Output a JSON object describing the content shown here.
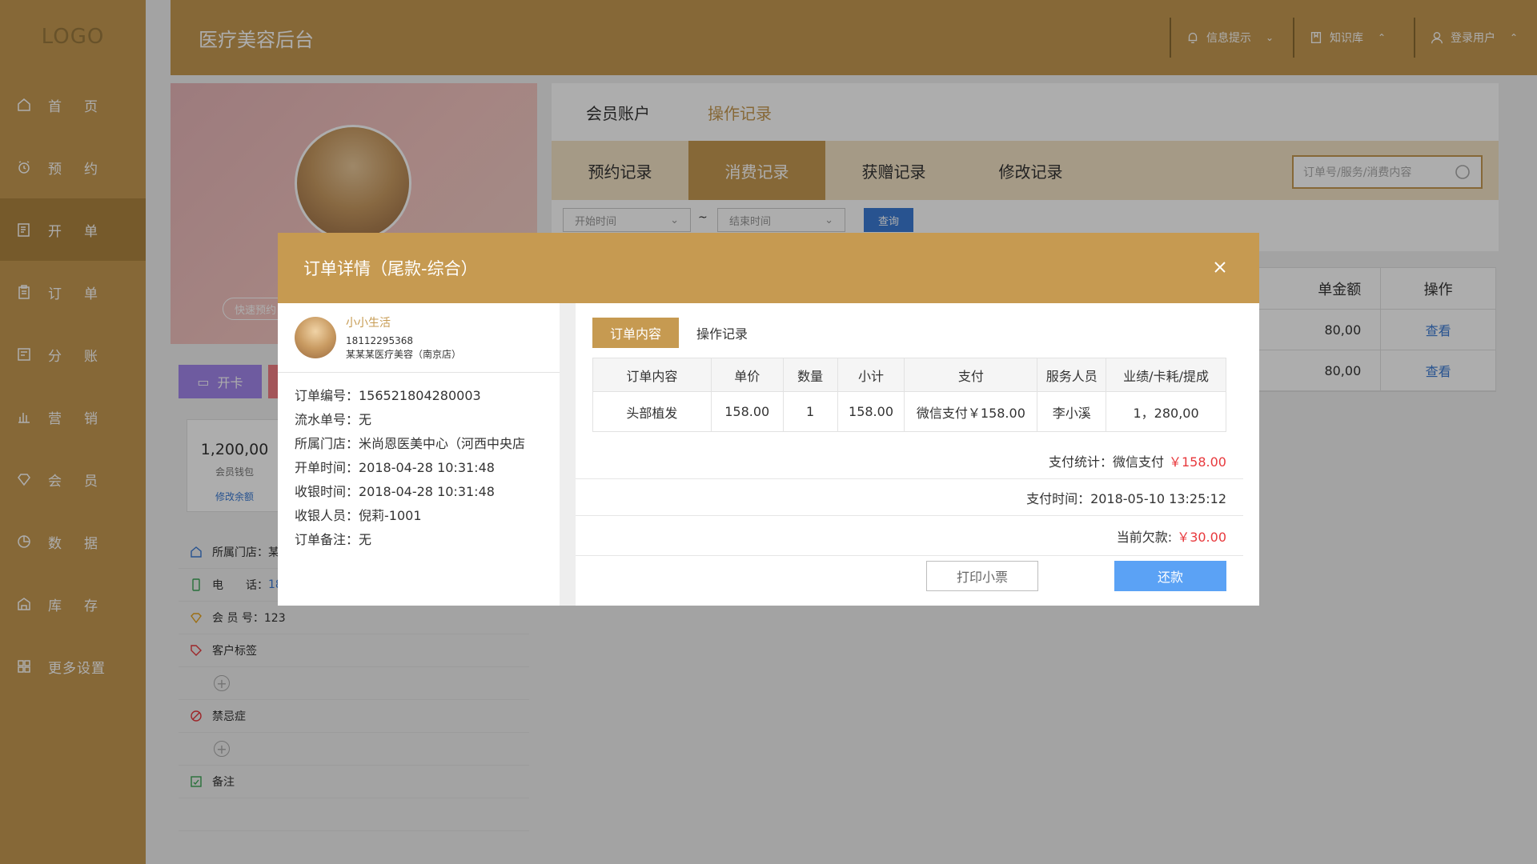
{
  "app": {
    "logo": "LOGO",
    "title": "医疗美容后台"
  },
  "sidebar": {
    "items": [
      {
        "label": "首页",
        "icon": "home-icon"
      },
      {
        "label": "预约",
        "icon": "alarm-icon"
      },
      {
        "label": "开单",
        "icon": "edit-doc-icon"
      },
      {
        "label": "订单",
        "icon": "clipboard-icon"
      },
      {
        "label": "分账",
        "icon": "ledger-icon"
      },
      {
        "label": "营销",
        "icon": "bar-chart-icon"
      },
      {
        "label": "会员",
        "icon": "diamond-icon"
      },
      {
        "label": "数据",
        "icon": "pie-icon"
      },
      {
        "label": "库存",
        "icon": "warehouse-icon"
      },
      {
        "label": "更多设置",
        "icon": "grid-icon"
      }
    ],
    "active_index": 2
  },
  "header": {
    "notifications": "信息提示",
    "knowledge": "知识库",
    "user": "登录用户"
  },
  "profile": {
    "quick_chip": "快速预约",
    "open_card": "开卡",
    "wallet_amount": "1,200,00",
    "wallet_label": "会员钱包",
    "wallet_link": "修改余额",
    "store_label": "所属门店：某",
    "phone_label": "电　　话：",
    "phone_value": "18",
    "member_no": "会 员 号：123",
    "tags_label": "客户标签",
    "contra_label": "禁忌症",
    "notes_label": "备注"
  },
  "main": {
    "top_tabs": [
      "会员账户",
      "操作记录"
    ],
    "sub_tabs": [
      "预约记录",
      "消费记录",
      "获赠记录",
      "修改记录"
    ],
    "search_placeholder": "订单号/服务/消费内容",
    "start_time": "开始时间",
    "end_time": "结束时间",
    "tilde": "~",
    "query": "查询",
    "table_header_amount": "单金额",
    "table_header_op": "操作",
    "rows": [
      {
        "amount": "80,00",
        "op": "查看"
      },
      {
        "amount": "80,00",
        "op": "查看"
      }
    ]
  },
  "modal": {
    "title": "订单详情（尾款-综合）",
    "customer": {
      "name": "小小生活",
      "phone": "18112295368",
      "store": "某某某医疗美容（南京店）"
    },
    "fields": [
      "订单编号：156521804280003",
      "流水单号：无",
      "所属门店：米尚恩医美中心（河西中央店",
      "开单时间：2018-04-28 10:31:48",
      "收银时间：2018-04-28 10:31:48",
      "收银人员：倪莉-1001",
      "订单备注：无"
    ],
    "tabs": [
      "订单内容",
      "操作记录"
    ],
    "table": {
      "headers": [
        "订单内容",
        "单价",
        "数量",
        "小计",
        "支付",
        "服务人员",
        "业绩/卡耗/提成"
      ],
      "rows": [
        [
          "头部植发",
          "158.00",
          "1",
          "158.00",
          "微信支付￥158.00",
          "李小溪",
          "1，280,00"
        ]
      ]
    },
    "pay_stat_label": "支付统计：微信支付",
    "pay_stat_value": "￥158.00",
    "pay_time": "支付时间：2018-05-10  13:25:12",
    "debt_label": "当前欠款:",
    "debt_value": "￥30.00",
    "print_button": "打印小票",
    "repay_button": "还款"
  }
}
